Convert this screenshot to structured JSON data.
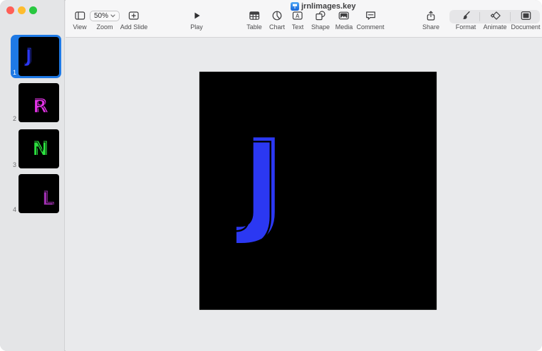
{
  "window": {
    "title": "jrnlimages.key"
  },
  "colors": {
    "selection_blue": "#1E79E5",
    "traffic_red": "#FF5F57",
    "traffic_yellow": "#FEBC2E",
    "traffic_green": "#28C840"
  },
  "toolbar": {
    "view": {
      "label": "View"
    },
    "zoom": {
      "label": "Zoom",
      "value": "50%"
    },
    "add_slide": {
      "label": "Add Slide"
    },
    "play": {
      "label": "Play"
    },
    "table": {
      "label": "Table"
    },
    "chart": {
      "label": "Chart"
    },
    "text": {
      "label": "Text"
    },
    "shape": {
      "label": "Shape"
    },
    "media": {
      "label": "Media"
    },
    "comment": {
      "label": "Comment"
    },
    "share": {
      "label": "Share"
    },
    "format": {
      "label": "Format"
    },
    "animate": {
      "label": "Animate"
    },
    "document": {
      "label": "Document"
    }
  },
  "sidebar": {
    "slides": [
      {
        "number": "1",
        "letter": "J",
        "color": "#2B38F2",
        "selected": true
      },
      {
        "number": "2",
        "letter": "R",
        "color": "#E433E8",
        "selected": false
      },
      {
        "number": "3",
        "letter": "N",
        "color": "#2BDE3E",
        "selected": false
      },
      {
        "number": "4",
        "letter": "L",
        "color": "#9E2FAF",
        "selected": false
      }
    ]
  },
  "main_slide": {
    "letter": "J",
    "color": "#2B38F2"
  }
}
